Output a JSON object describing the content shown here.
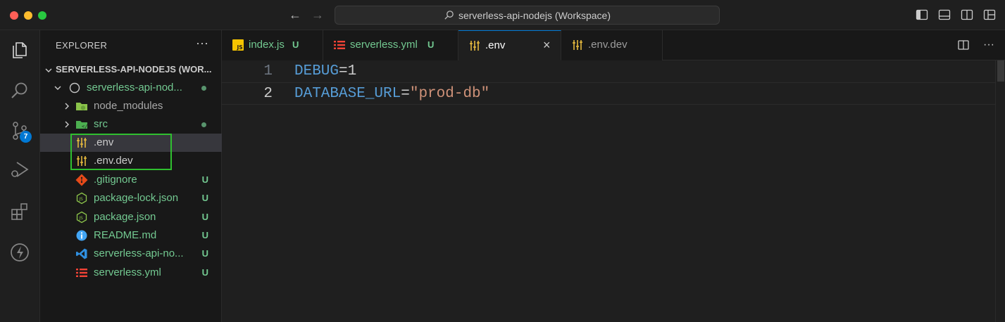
{
  "window": {
    "title": "serverless-api-nodejs (Workspace)"
  },
  "activity": {
    "scm_badge": "7"
  },
  "sidebar": {
    "header": "EXPLORER",
    "more": "···",
    "workspace": "SERVERLESS-API-NODEJS (WOR...",
    "folder": "serverless-api-nod...",
    "items": [
      {
        "label": "node_modules",
        "status": ""
      },
      {
        "label": "src",
        "status": "dot"
      },
      {
        "label": ".env",
        "status": ""
      },
      {
        "label": ".env.dev",
        "status": ""
      },
      {
        "label": ".gitignore",
        "status": "U"
      },
      {
        "label": "package-lock.json",
        "status": "U"
      },
      {
        "label": "package.json",
        "status": "U"
      },
      {
        "label": "README.md",
        "status": "U"
      },
      {
        "label": "serverless-api-no...",
        "status": "U"
      },
      {
        "label": "serverless.yml",
        "status": "U"
      }
    ]
  },
  "tabs": [
    {
      "label": "index.js",
      "status": "U"
    },
    {
      "label": "serverless.yml",
      "status": "U"
    },
    {
      "label": ".env",
      "close": "×"
    },
    {
      "label": ".env.dev"
    }
  ],
  "editor": {
    "lines": [
      {
        "number": "1",
        "key": "DEBUG",
        "eq": "=",
        "value": "1"
      },
      {
        "number": "2",
        "key": "DATABASE_URL",
        "eq": "=",
        "value": "\"prod-db\""
      }
    ]
  },
  "colors": {
    "accent": "#0078d4",
    "git_untracked": "#73c991",
    "highlight": "#2fbf2f"
  }
}
